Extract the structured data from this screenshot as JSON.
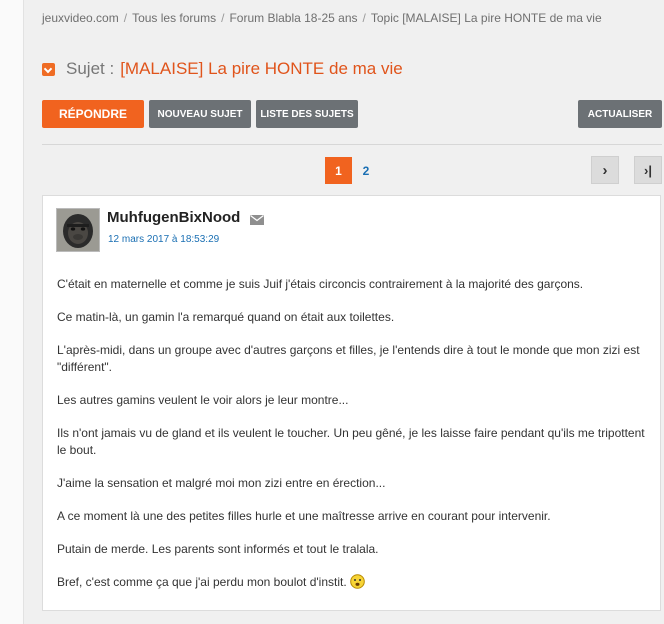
{
  "breadcrumb": {
    "items": [
      "jeuxvideo.com",
      "Tous les forums",
      "Forum Blabla 18-25 ans",
      "Topic [MALAISE] La pire HONTE de ma vie"
    ],
    "separator": "/"
  },
  "topic": {
    "prefix": "Sujet :",
    "title": "[MALAISE] La pire HONTE de ma vie"
  },
  "toolbar": {
    "reply_label": "Répondre",
    "new_topic_label": "Nouveau sujet",
    "topic_list_label": "Liste des sujets",
    "refresh_label": "Actualiser"
  },
  "pagination": {
    "current": "1",
    "next_page": "2",
    "next_arrow": "›",
    "last_arrow": "›|"
  },
  "post": {
    "author": "MuhfugenBixNood",
    "date": "12 mars 2017 à 18:53:29",
    "paragraphs": [
      "C'était en maternelle et comme je suis Juif j'étais circoncis contrairement à la majorité des garçons.",
      "Ce matin-là, un gamin l'a remarqué quand on était aux toilettes.",
      "L'après-midi, dans un groupe avec d'autres garçons et filles, je l'entends dire à tout le monde que mon zizi est \"différent\".",
      "Les autres gamins veulent le voir alors je leur montre...",
      "Ils n'ont jamais vu de gland et ils veulent le toucher. Un peu gêné, je les laisse faire pendant qu'ils me tripottent le bout.",
      "J'aime la sensation et malgré moi mon zizi entre en érection...",
      "A ce moment là une des petites filles hurle et une maîtresse arrive en courant pour intervenir.",
      "Putain de merde. Les parents sont informés et tout le tralala.",
      "Bref, c'est comme ça que j'ai perdu mon boulot d'instit."
    ]
  },
  "colors": {
    "accent": "#f1631f",
    "title": "#e0541b",
    "link": "#1a6fb3",
    "button_gray": "#6c7175"
  },
  "icons": {
    "title": "chevron-down-icon",
    "mail": "mail-icon",
    "smiley": "smiley-icon",
    "next": "chevron-right-icon",
    "last": "last-page-icon"
  }
}
